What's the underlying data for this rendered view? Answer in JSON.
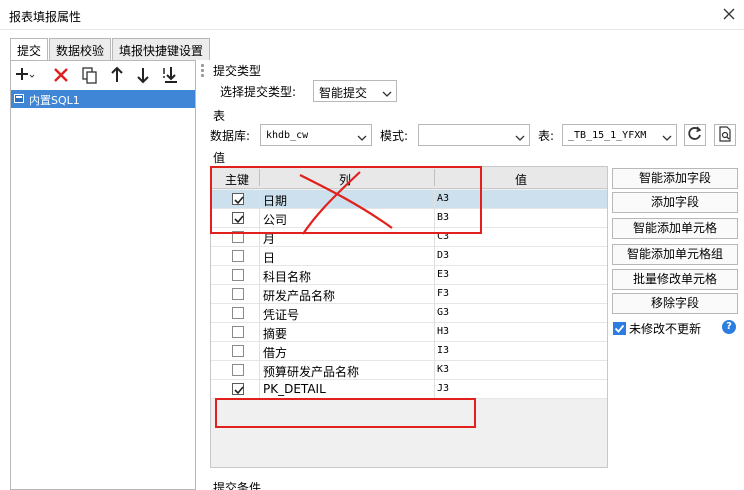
{
  "window": {
    "title": "报表填报属性"
  },
  "tabs": [
    {
      "label": "提交"
    },
    {
      "label": "数据校验"
    },
    {
      "label": "填报快捷键设置"
    }
  ],
  "left": {
    "items": [
      {
        "label": "内置SQL1"
      }
    ]
  },
  "submit_type": {
    "section": "提交类型",
    "label": "选择提交类型:",
    "value": "智能提交"
  },
  "table_section": {
    "section": "表",
    "db_label": "数据库:",
    "db_value": "khdb_cw",
    "schema_label": "模式:",
    "schema_value": "",
    "table_label": "表:",
    "table_value": "_TB_15_1_YFXM"
  },
  "values": {
    "section": "值",
    "headers": {
      "pk": "主键",
      "col": "列",
      "val": "值"
    },
    "rows": [
      {
        "checked": true,
        "column": "日期",
        "value": "A3"
      },
      {
        "checked": true,
        "column": "公司",
        "value": "B3"
      },
      {
        "checked": false,
        "column": "月",
        "value": "C3"
      },
      {
        "checked": false,
        "column": "日",
        "value": "D3"
      },
      {
        "checked": false,
        "column": "科目名称",
        "value": "E3"
      },
      {
        "checked": false,
        "column": "研发产品名称",
        "value": "F3"
      },
      {
        "checked": false,
        "column": "凭证号",
        "value": "G3"
      },
      {
        "checked": false,
        "column": "摘要",
        "value": "H3"
      },
      {
        "checked": false,
        "column": "借方",
        "value": "I3"
      },
      {
        "checked": false,
        "column": "预算研发产品名称",
        "value": "K3"
      },
      {
        "checked": true,
        "column": "PK_DETAIL",
        "value": "J3"
      }
    ]
  },
  "actions": [
    {
      "label": "智能添加字段"
    },
    {
      "label": "添加字段"
    },
    {
      "label": "智能添加单元格"
    },
    {
      "label": "智能添加单元格组"
    },
    {
      "label": "批量修改单元格"
    },
    {
      "label": "移除字段"
    }
  ],
  "options": {
    "unchanged_label": "未修改不更新",
    "unchanged_checked": true,
    "help": "?"
  },
  "condition": {
    "section": "提交条件"
  },
  "colors": {
    "accent": "#2b7de0",
    "selection": "#3f86d6",
    "annotation": "#e2201c"
  }
}
